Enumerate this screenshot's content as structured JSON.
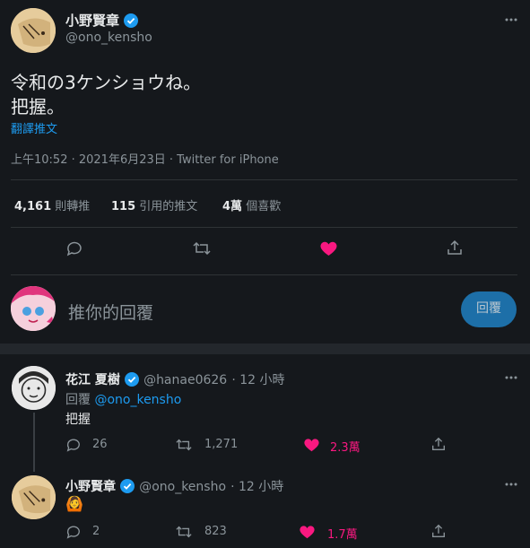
{
  "main_tweet": {
    "author_name": "小野賢章",
    "author_handle": "@ono_kensho",
    "text_line1": "令和の3ケンショウね。",
    "text_line2": "把握。",
    "translate_label": "翻譯推文",
    "timestamp": "上午10:52 · 2021年6月23日 · Twitter for iPhone",
    "stats": {
      "retweets_num": "4,161",
      "retweets_label": "則轉推",
      "quotes_num": "115",
      "quotes_label": "引用的推文",
      "likes_num": "4萬",
      "likes_label": "個喜歡"
    }
  },
  "composer": {
    "placeholder": "推你的回覆",
    "button_label": "回覆"
  },
  "replies": [
    {
      "author_name": "花江 夏樹",
      "author_handle": "@hanae0626",
      "time": "· 12 小時",
      "reply_to_prefix": "回覆",
      "reply_to_handle": "@ono_kensho",
      "text": "把握",
      "reply_count": "26",
      "retweet_count": "1,271",
      "like_count": "2.3萬"
    },
    {
      "author_name": "小野賢章",
      "author_handle": "@ono_kensho",
      "time": "· 12 小時",
      "emoji": "🙆",
      "reply_count": "2",
      "retweet_count": "823",
      "like_count": "1.7萬"
    }
  ],
  "colors": {
    "background": "#15181c",
    "accent": "#1d9bf0",
    "like": "#f91880"
  }
}
